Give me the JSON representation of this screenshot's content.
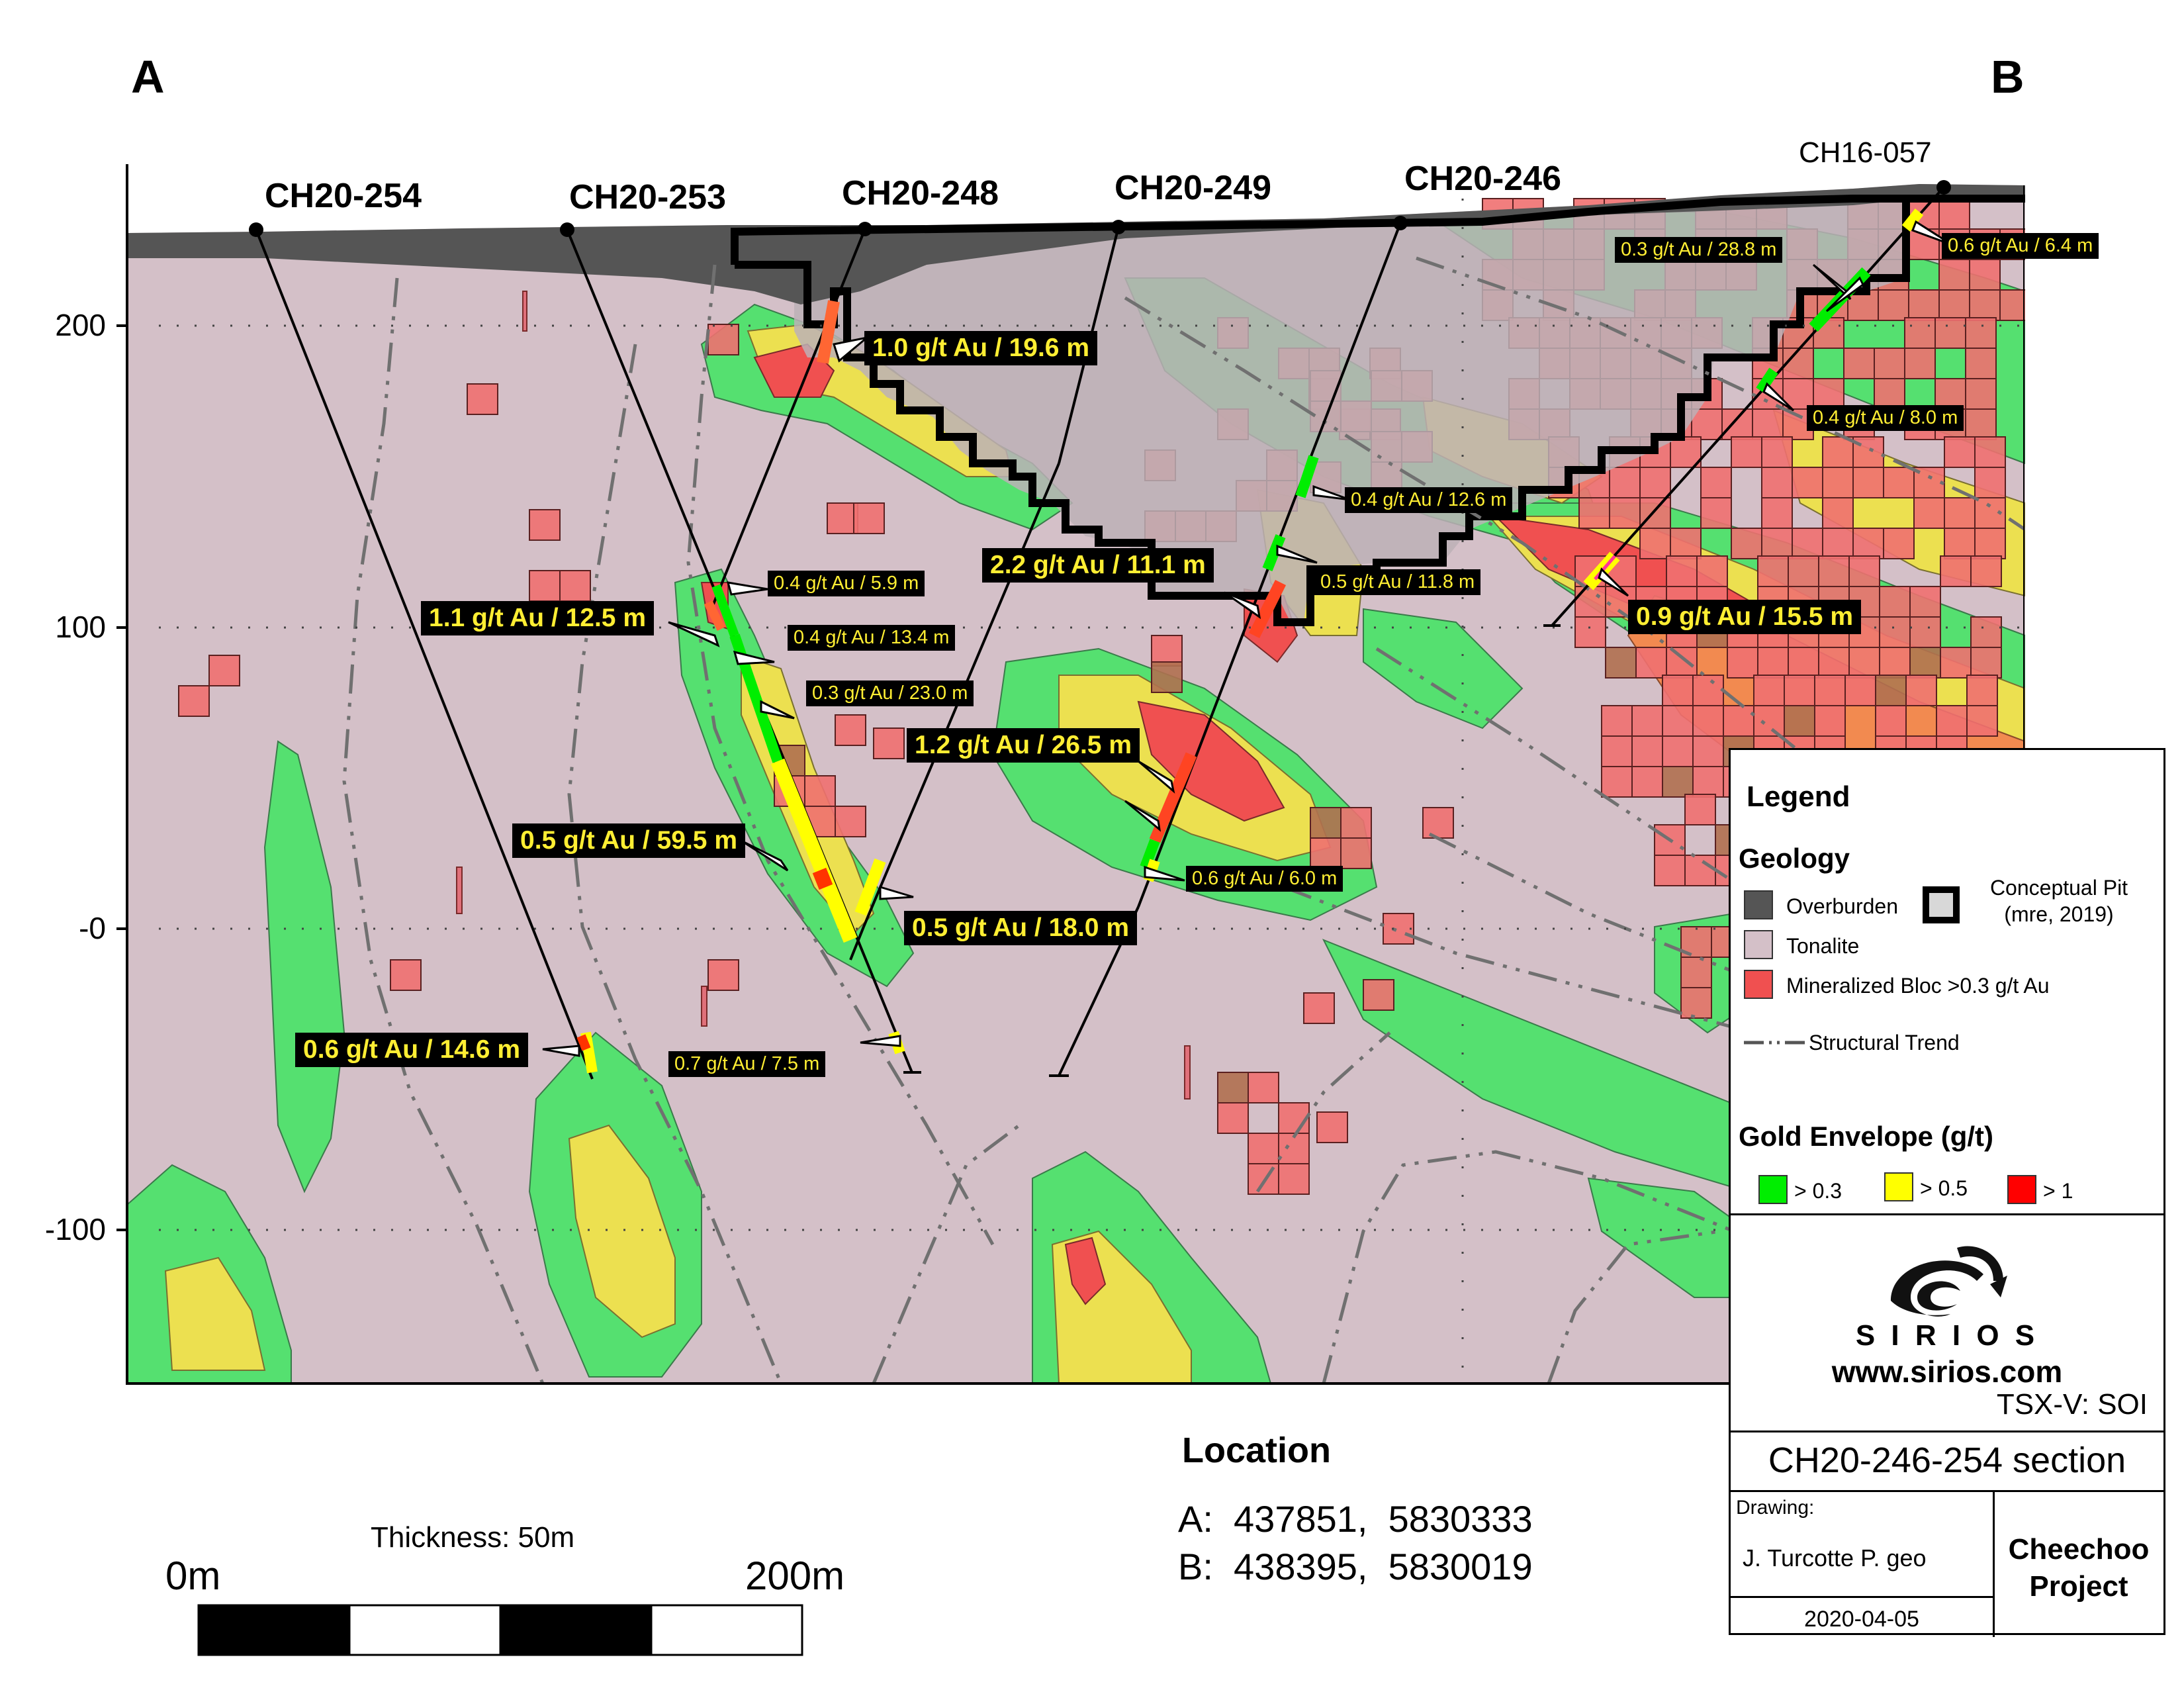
{
  "corners": {
    "a": "A",
    "b": "B"
  },
  "drill_holes": [
    {
      "name": "CH20-254"
    },
    {
      "name": "CH20-253"
    },
    {
      "name": "CH20-248"
    },
    {
      "name": "CH20-249"
    },
    {
      "name": "CH20-246"
    },
    {
      "name": "CH16-057"
    }
  ],
  "elevation_axis": {
    "ticks": [
      "200",
      "100",
      "-0",
      "-100"
    ],
    "values": [
      200,
      100,
      0,
      -100
    ]
  },
  "intercepts_major": [
    {
      "text": "1.0 g/t Au / 19.6 m"
    },
    {
      "text": "2.2 g/t Au / 11.1 m"
    },
    {
      "text": "1.1 g/t Au / 12.5 m"
    },
    {
      "text": "1.2 g/t Au / 26.5 m"
    },
    {
      "text": "0.5 g/t Au / 59.5 m"
    },
    {
      "text": "0.5 g/t Au / 18.0 m"
    },
    {
      "text": "0.6 g/t Au / 14.6 m"
    },
    {
      "text": "0.9 g/t Au / 15.5 m"
    }
  ],
  "intercepts_minor": [
    {
      "text": "0.3 g/t Au / 28.8 m"
    },
    {
      "text": "0.6 g/t Au / 6.4 m"
    },
    {
      "text": "0.4 g/t Au / 8.0 m"
    },
    {
      "text": "0.4 g/t Au / 12.6 m"
    },
    {
      "text": "0.5 g/t Au / 11.8 m"
    },
    {
      "text": "0.4 g/t Au / 5.9 m"
    },
    {
      "text": "0.4 g/t Au / 13.4 m"
    },
    {
      "text": "0.3 g/t Au / 23.0 m"
    },
    {
      "text": "0.6 g/t Au / 6.0 m"
    },
    {
      "text": "0.7 g/t Au / 7.5 m"
    }
  ],
  "scale_bar": {
    "thickness": "Thickness: 50m",
    "start": "0m",
    "end": "200m"
  },
  "location": {
    "title": "Location",
    "a": "A:  437851,  5830333",
    "b": "B:  438395,  5830019"
  },
  "legend": {
    "title": "Legend",
    "geology_title": "Geology",
    "overburden": "Overburden",
    "tonalite": "Tonalite",
    "mineralized": "Mineralized Bloc >0.3 g/t Au",
    "pit_line1": "Conceptual Pit",
    "pit_line2": "(mre, 2019)",
    "structural": "Structural Trend",
    "envelope_title": "Gold Envelope (g/t)",
    "env_low": "> 0.3",
    "env_mid": "> 0.5",
    "env_high": "> 1"
  },
  "title_block": {
    "logo_word": "S I R I O S",
    "website": "www.sirios.com",
    "ticker": "TSX-V: SOI",
    "section": "CH20-246-254 section",
    "drawing_label": "Drawing:",
    "author": "J. Turcotte P. geo",
    "date": "2020-04-05",
    "project": "Cheechoo Project"
  },
  "colors": {
    "tonalite": "#d4c0c8",
    "overburden": "#555555",
    "green": "#55e070",
    "yellow": "#ece050",
    "red": "#f05050",
    "orange": "#f28a50",
    "block": "#f07070",
    "pit_fill": "#bcb0b6",
    "legend_green": "#00ee00",
    "legend_yellow": "#ffff00",
    "legend_red": "#ff0000"
  }
}
